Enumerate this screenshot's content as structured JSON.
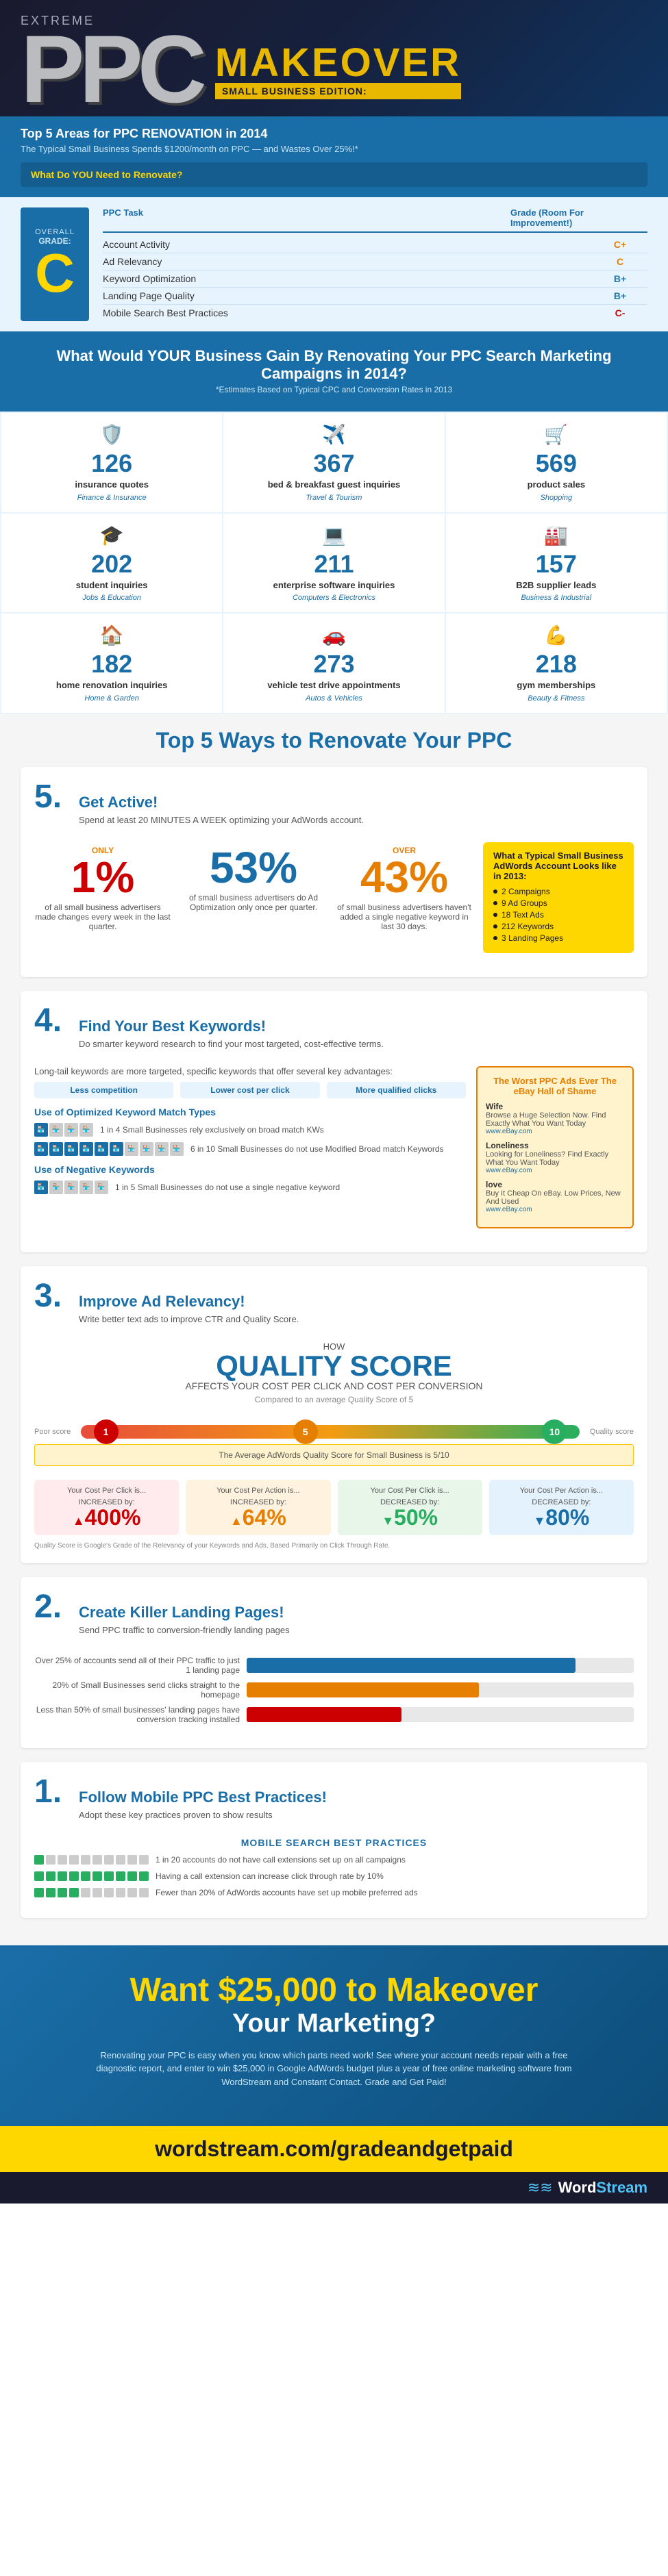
{
  "header": {
    "extreme": "Extreme",
    "ppc": "PPC",
    "makeover": "MAKEOVER",
    "edition": "SMALL BUSINESS EDITION:",
    "top5_title": "Top 5 Areas for PPC RENOVATION in 2014",
    "top5_subtitle": "The Typical Small Business Spends $1200/month on PPC — and Wastes Over 25%!*",
    "what_do_you_need": "What Do YOU Need to Renovate?",
    "ppc_task_col": "PPC Task",
    "grade_col": "Grade (Room For Improvement!)",
    "grades": [
      {
        "task": "Account Activity",
        "grade": "C+"
      },
      {
        "task": "Ad Relevancy",
        "grade": "C"
      },
      {
        "task": "Keyword Optimization",
        "grade": "B+"
      },
      {
        "task": "Landing Page Quality",
        "grade": "B+"
      },
      {
        "task": "Mobile Search Best Practices",
        "grade": "C-"
      }
    ],
    "overall_grade_label": "OVERALL",
    "overall_grade_sublabel": "GRADE:",
    "overall_grade": "C"
  },
  "what_would": {
    "title": "What Would YOUR Business Gain By Renovating Your PPC Search Marketing Campaigns in 2014?",
    "subtitle": "*Estimates Based on Typical CPC and Conversion Rates in 2013",
    "stats": [
      {
        "number": "126",
        "label": "insurance quotes",
        "category": "Finance & Insurance",
        "icon": "🛡"
      },
      {
        "number": "367",
        "label": "bed & breakfast guest inquiries",
        "category": "Travel & Tourism",
        "icon": "✈"
      },
      {
        "number": "569",
        "label": "product sales",
        "category": "Shopping",
        "icon": "🛒"
      },
      {
        "number": "202",
        "label": "student inquiries",
        "category": "Jobs & Education",
        "icon": "🎓"
      },
      {
        "number": "211",
        "label": "enterprise software inquiries",
        "category": "Computers & Electronics",
        "icon": "💻"
      },
      {
        "number": "157",
        "label": "B2B supplier leads",
        "category": "Business & Industrial",
        "icon": "🏭"
      },
      {
        "number": "182",
        "label": "home renovation inquiries",
        "category": "Home & Garden",
        "icon": "🏠"
      },
      {
        "number": "273",
        "label": "vehicle test drive appointments",
        "category": "Autos & Vehicles",
        "icon": "🚗"
      },
      {
        "number": "218",
        "label": "gym memberships",
        "category": "Beauty & Fitness",
        "icon": "💪"
      }
    ]
  },
  "top5_ways": {
    "title": "Top 5 Ways to Renovate Your PPC",
    "section5": {
      "number": "5.",
      "title": "Get Active!",
      "subtitle": "Spend at least 20 MINUTES A WEEK optimizing your AdWords account.",
      "typical_account_title": "What a Typical Small Business AdWords Account Looks like in 2013:",
      "typical_account_items": [
        "2 Campaigns",
        "9 Ad Groups",
        "18 Text Ads",
        "212 Keywords",
        "3 Landing Pages"
      ],
      "stats": [
        {
          "prefix": "ONLY",
          "number": "1%",
          "desc": "of all small business advertisers made changes every week in the last quarter.",
          "color": "pct-1"
        },
        {
          "prefix": "",
          "number": "53%",
          "desc": "of small business advertisers do Ad Optimization only once per quarter.",
          "color": "pct-53"
        },
        {
          "prefix": "OVER",
          "number": "43%",
          "desc": "of small business advertisers haven't added a single negative keyword in last 30 days.",
          "color": "pct-43"
        }
      ]
    },
    "section4": {
      "number": "4.",
      "title": "Find Your Best Keywords!",
      "subtitle": "Do smarter keyword research to find your most targeted, cost-effective terms.",
      "long_tail_title": "Long-tail keywords are more targeted, specific keywords that offer several key advantages:",
      "advantages": [
        "Less competition",
        "Lower cost per click",
        "More qualified clicks"
      ],
      "match_types_title": "Use of Optimized Keyword Match Types",
      "match_rows": [
        {
          "stores_filled": 1,
          "stores_total": 4,
          "text": "1 in 4 Small Businesses rely exclusively on broad match KWs"
        },
        {
          "stores_filled": 6,
          "stores_total": 10,
          "text": "6 in 10 Small Businesses do not use Modified Broad match Keywords"
        }
      ],
      "negative_kw_title": "Use of Negative Keywords",
      "negative_kw_rows": [
        {
          "stores_filled": 1,
          "stores_total": 5,
          "text": "1 in 5 Small Businesses do not use a single negative keyword"
        }
      ],
      "hall_of_shame_title": "The Worst PPC Ads Ever The eBay Hall of Shame",
      "shame_items": [
        {
          "title": "Wife",
          "text": "Browse a Huge Selection Now. Find Exactly What You Want Today",
          "url": "www.eBay.com"
        },
        {
          "title": "Loneliness",
          "text": "Looking for Loneliness? Find Exactly What You Want Today",
          "url": "www.eBay.com"
        },
        {
          "title": "love",
          "text": "Buy It Cheap On eBay. Low Prices, New And Used",
          "url": "www.eBay.com"
        }
      ]
    },
    "section3": {
      "number": "3.",
      "title": "Improve Ad Relevancy!",
      "subtitle": "Write better text ads to improve CTR and Quality Score.",
      "how_label": "HOW",
      "quality_score_title": "QUALITY SCORE",
      "affects_text": "AFFECTS YOUR COST PER CLICK AND COST PER CONVERSION",
      "compared_text": "Compared to an average Quality Score of 5",
      "scale_min": "Poor score",
      "scale_mid": "5",
      "scale_mid_note": "The Average AdWords Quality Score for Small Business is 5/10",
      "scale_max": "10",
      "scale_max_label": "Quality score",
      "results": [
        {
          "label": "Your Cost Per Click is...",
          "pct": "400%",
          "direction": "INCREASED by:",
          "color": "qs-red",
          "bg": "qs-bad"
        },
        {
          "label": "Your Cost Per Action is...",
          "pct": "64%",
          "direction": "INCREASED by:",
          "color": "qs-orange",
          "bg": "qs-avg"
        },
        {
          "label": "Your Cost Per Click is...",
          "pct": "50%",
          "direction": "DECREASED by:",
          "color": "qs-green",
          "bg": "qs-good"
        },
        {
          "label": "Your Cost Per Action is...",
          "pct": "80%",
          "direction": "DECREASED by:",
          "color": "qs-blue",
          "bg": "qs-great"
        }
      ],
      "qs_note": "Quality Score is Google's Grade of the Relevancy of your Keywords and Ads, Based Primarily on Click Through Rate."
    },
    "section2": {
      "number": "2.",
      "title": "Create Killer Landing Pages!",
      "subtitle": "Send PPC traffic to conversion-friendly landing pages",
      "bars": [
        {
          "label": "Over 25% of accounts send all of their PPC traffic to just 1 landing page",
          "pct": 85
        },
        {
          "label": "20% of Small Businesses send clicks straight to the homepage",
          "pct": 60
        },
        {
          "label": "Less than 50% of small businesses' landing pages have conversion tracking installed",
          "pct": 40
        }
      ]
    },
    "section1": {
      "number": "1.",
      "title": "Follow Mobile PPC Best Practices!",
      "subtitle": "Adopt these key practices proven to show results",
      "mobile_label": "MOBILE SEARCH BEST PRACTICES",
      "rows": [
        {
          "text": "1 in 20 accounts do not have call extensions set up on all campaigns",
          "filled": 1,
          "total": 20
        },
        {
          "text": "Having a call extension can increase click through rate by 10%",
          "filled": 10,
          "total": 10
        },
        {
          "text": "Fewer than 20% of AdWords accounts have set up mobile preferred ads",
          "filled": 4,
          "total": 20
        }
      ]
    }
  },
  "cta": {
    "want": "Want $25,000 to Makeover",
    "your_marketing": "Your Marketing?",
    "desc": "Renovating your PPC is easy when you know which parts need work! See where your account needs repair with a free diagnostic report, and enter to win $25,000 in Google AdWords budget plus a year of free online marketing software from WordStream and Constant Contact. Grade and Get Paid!",
    "url": "wordstream.com/gradeandgetpaid",
    "grade_get_paid": "Grade and Get Paid!",
    "wordstream": "WordStream"
  }
}
